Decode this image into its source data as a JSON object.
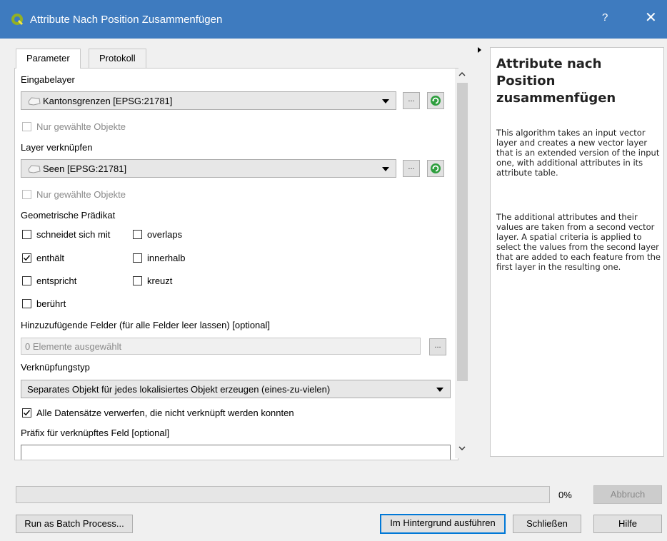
{
  "window": {
    "title": "Attribute Nach Position Zusammenfügen",
    "help_glyph": "?",
    "close_glyph": "✕"
  },
  "tabs": [
    {
      "label": "Parameter",
      "active": true
    },
    {
      "label": "Protokoll",
      "active": false
    }
  ],
  "params": {
    "input_layer_label": "Eingabelayer",
    "input_layer_value": "Kantonsgrenzen [EPSG:21781]",
    "input_selected_only": "Nur gewählte Objekte",
    "join_layer_label": "Layer verknüpfen",
    "join_layer_value": "Seen [EPSG:21781]",
    "join_selected_only": "Nur gewählte Objekte",
    "ellipsis": "...",
    "predicate_label": "Geometrische Prädikat",
    "predicates": [
      {
        "label": "schneidet sich mit",
        "checked": false
      },
      {
        "label": "overlaps",
        "checked": false
      },
      {
        "label": "enthält",
        "checked": true
      },
      {
        "label": "innerhalb",
        "checked": false
      },
      {
        "label": "entspricht",
        "checked": false
      },
      {
        "label": "kreuzt",
        "checked": false
      },
      {
        "label": "berührt",
        "checked": false
      }
    ],
    "fields_label": "Hinzuzufügende Felder (für alle Felder leer lassen) [optional]",
    "fields_value": "0 Elemente ausgewählt",
    "join_type_label": "Verknüpfungstyp",
    "join_type_value": "Separates Objekt für jedes lokalisiertes Objekt erzeugen (eines-zu-vielen)",
    "discard_label": "Alle Datensätze verwerfen, die nicht verknüpft werden konnten",
    "discard_checked": true,
    "prefix_label": "Präfix für verknüpftes Feld [optional]",
    "prefix_value": ""
  },
  "help": {
    "title": "Attribute nach Position zusammenfügen",
    "paragraph1": "This algorithm takes an input vector layer and creates a new vector layer that is an extended version of the input one, with additional attributes in its attribute table.",
    "paragraph2": "The additional attributes and their values are taken from a second vector layer. A spatial criteria is applied to select the values from the second layer that are added to each feature from the first layer in the resulting one."
  },
  "progress": {
    "value": 0,
    "label": "0%"
  },
  "buttons": {
    "cancel": "Abbruch",
    "batch": "Run as Batch Process...",
    "background": "Im Hintergrund ausführen",
    "close": "Schließen",
    "help": "Hilfe"
  },
  "colors": {
    "titlebar": "#3e7bbf",
    "progress": "#06b025",
    "focus": "#0078d7",
    "iterate_green": "#2e9e3e"
  }
}
